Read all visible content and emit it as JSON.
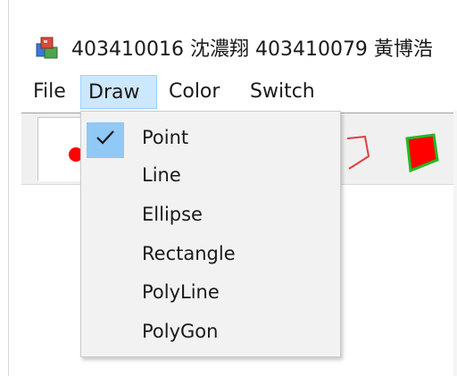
{
  "window": {
    "title": "403410016 沈濃翔 403410079 黃博浩"
  },
  "menu": {
    "items": [
      "File",
      "Draw",
      "Color",
      "Switch"
    ],
    "active_index": 1
  },
  "toolbar": {
    "tools": [
      "point-tool",
      "polyline-tool",
      "polygon-tool"
    ],
    "colors": {
      "point": "#ff0000",
      "polygon_fill": "#ff0000",
      "polygon_edge": "#22bb22",
      "polyline": "#e04040"
    }
  },
  "draw_menu": {
    "items": [
      {
        "label": "Point",
        "checked": true
      },
      {
        "label": "Line",
        "checked": false
      },
      {
        "label": "Ellipse",
        "checked": false
      },
      {
        "label": "Rectangle",
        "checked": false
      },
      {
        "label": "PolyLine",
        "checked": false
      },
      {
        "label": "PolyGon",
        "checked": false
      }
    ],
    "check_glyph": "✓"
  }
}
